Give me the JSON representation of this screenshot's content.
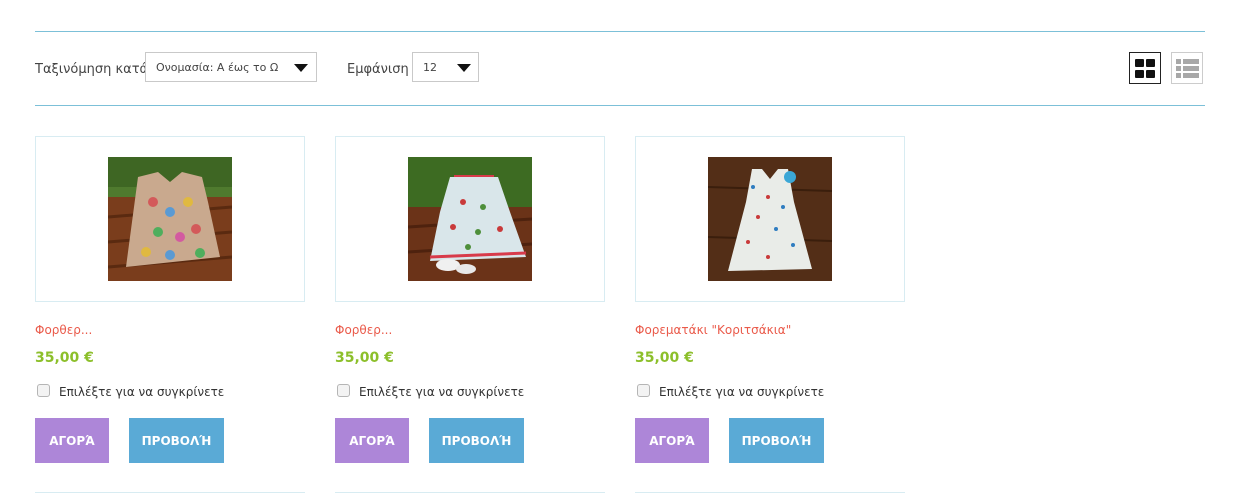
{
  "toolbar": {
    "sort_label": "Ταξινόμηση κατά",
    "sort_value": "Ονομασία: Α έως το Ω",
    "show_label": "Εμφάνιση",
    "show_value": "12"
  },
  "colors": {
    "divider": "#7cc0d8",
    "product_name": "#ea5a4a",
    "price": "#8cbf2a",
    "buy_button": "#ad86d8",
    "view_button": "#5aaad6"
  },
  "icons": [
    "grid-view-icon",
    "list-view-icon",
    "chevron-down-icon"
  ],
  "products": [
    {
      "name": "Φορθερ...",
      "price": "35,00 €",
      "compare_label": "Επιλέξτε για να συγκρίνετε",
      "buy_label": "ΑΓΟΡΆ",
      "view_label": "ΠΡΟΒΟΛΉ"
    },
    {
      "name": "Φορθερ...",
      "price": "35,00 €",
      "compare_label": "Επιλέξτε για να συγκρίνετε",
      "buy_label": "ΑΓΟΡΆ",
      "view_label": "ΠΡΟΒΟΛΉ"
    },
    {
      "name": "Φορεματάκι \"Κοριτσάκια\"",
      "price": "35,00 €",
      "compare_label": "Επιλέξτε για να συγκρίνετε",
      "buy_label": "ΑΓΟΡΆ",
      "view_label": "ΠΡΟΒΟΛΉ"
    }
  ]
}
